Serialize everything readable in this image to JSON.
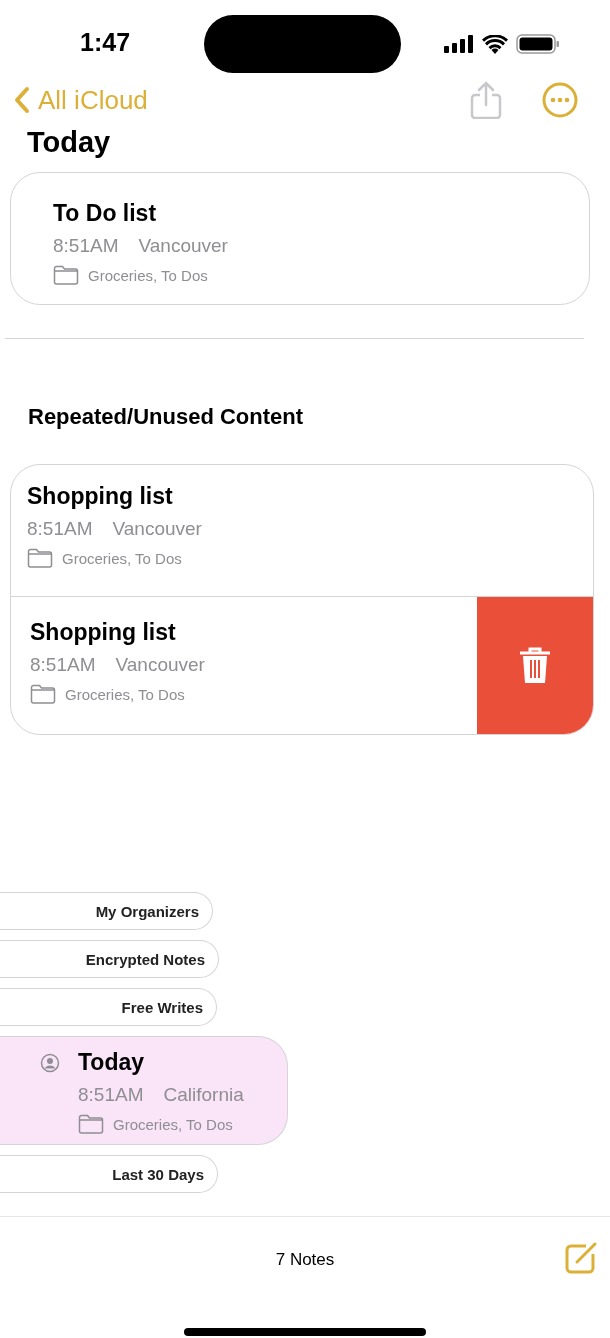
{
  "status_bar": {
    "time": "1:47"
  },
  "nav": {
    "back_label": "All iCloud"
  },
  "today": {
    "title": "Today",
    "note": {
      "title": "To Do list",
      "time": "8:51AM",
      "location": "Vancouver",
      "folders": "Groceries, To Dos"
    }
  },
  "repeated": {
    "title": "Repeated/Unused Content",
    "notes": [
      {
        "title": "Shopping list",
        "time": "8:51AM",
        "location": "Vancouver",
        "folders": "Groceries, To Dos",
        "swiped": false
      },
      {
        "title": "Shopping list",
        "time": "8:51AM",
        "location": "Vancouver",
        "folders": "Groceries, To Dos",
        "swiped": true
      }
    ]
  },
  "stack": [
    {
      "kind": "folder",
      "label": "My Organizers"
    },
    {
      "kind": "folder",
      "label": "Encrypted Notes"
    },
    {
      "kind": "folder",
      "label": "Free Writes"
    },
    {
      "kind": "note",
      "title": "Today",
      "time": "8:51AM",
      "location": "California",
      "folders": "Groceries, To Dos",
      "selected": true
    },
    {
      "kind": "folder",
      "label": "Last 30 Days"
    }
  ],
  "toolbar": {
    "count": "7 Notes"
  }
}
